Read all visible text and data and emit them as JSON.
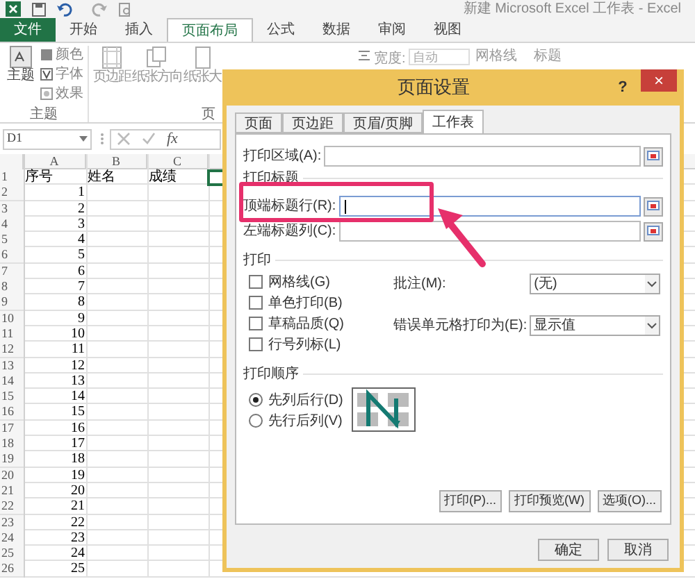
{
  "window": {
    "title": "新建 Microsoft Excel 工作表 - Excel"
  },
  "ribbon_tabs": [
    {
      "label": "文件",
      "kind": "file",
      "selected": false
    },
    {
      "label": "开始",
      "kind": "tab",
      "selected": false
    },
    {
      "label": "插入",
      "kind": "tab",
      "selected": false
    },
    {
      "label": "页面布局",
      "kind": "tab",
      "selected": true
    },
    {
      "label": "公式",
      "kind": "tab",
      "selected": false
    },
    {
      "label": "数据",
      "kind": "tab",
      "selected": false
    },
    {
      "label": "审阅",
      "kind": "tab",
      "selected": false
    },
    {
      "label": "视图",
      "kind": "tab",
      "selected": false
    }
  ],
  "ribbon": {
    "theme_group": {
      "big_button": "主题",
      "items": [
        "颜色",
        "字体",
        "效果"
      ],
      "label": "主题"
    },
    "page_setup_group": {
      "buttons": [
        "页边距",
        "纸张方向",
        "纸张大"
      ],
      "label": "页"
    },
    "scale_group": {
      "label": "宽度:",
      "value": "自动"
    },
    "sheet_options": [
      "网格线",
      "标题"
    ]
  },
  "formula_bar": {
    "name_box": "D1",
    "function_label": "fx"
  },
  "sheet": {
    "columns": [
      "A",
      "B",
      "C"
    ],
    "rows": [
      {
        "number": "1",
        "cells": [
          "序号",
          "姓名",
          "成绩"
        ]
      },
      {
        "number": "2",
        "cells": [
          "1"
        ]
      },
      {
        "number": "3",
        "cells": [
          "2"
        ]
      },
      {
        "number": "4",
        "cells": [
          "3"
        ]
      },
      {
        "number": "5",
        "cells": [
          "4"
        ]
      },
      {
        "number": "6",
        "cells": [
          "5"
        ]
      },
      {
        "number": "7",
        "cells": [
          "6"
        ]
      },
      {
        "number": "8",
        "cells": [
          "7"
        ]
      },
      {
        "number": "9",
        "cells": [
          "8"
        ]
      },
      {
        "number": "10",
        "cells": [
          "9"
        ]
      },
      {
        "number": "11",
        "cells": [
          "10"
        ]
      },
      {
        "number": "12",
        "cells": [
          "11"
        ]
      },
      {
        "number": "13",
        "cells": [
          "12"
        ]
      },
      {
        "number": "14",
        "cells": [
          "13"
        ]
      },
      {
        "number": "15",
        "cells": [
          "14"
        ]
      },
      {
        "number": "16",
        "cells": [
          "15"
        ]
      },
      {
        "number": "17",
        "cells": [
          "16"
        ]
      },
      {
        "number": "18",
        "cells": [
          "17"
        ]
      },
      {
        "number": "19",
        "cells": [
          "18"
        ]
      },
      {
        "number": "20",
        "cells": [
          "19"
        ]
      },
      {
        "number": "21",
        "cells": [
          "20"
        ]
      },
      {
        "number": "22",
        "cells": [
          "21"
        ]
      },
      {
        "number": "23",
        "cells": [
          "22"
        ]
      },
      {
        "number": "24",
        "cells": [
          "23"
        ]
      },
      {
        "number": "25",
        "cells": [
          "24"
        ]
      },
      {
        "number": "26",
        "cells": [
          "25"
        ]
      }
    ]
  },
  "dialog": {
    "title": "页面设置",
    "help": "?",
    "close": "×",
    "tabs": [
      {
        "label": "页面",
        "selected": false
      },
      {
        "label": "页边距",
        "selected": false
      },
      {
        "label": "页眉/页脚",
        "selected": false
      },
      {
        "label": "工作表",
        "selected": true
      }
    ],
    "print_area": {
      "label": "打印区域(A):"
    },
    "print_titles": {
      "heading": "打印标题",
      "fields": [
        {
          "label": "顶端标题行(R):",
          "focused": true
        },
        {
          "label": "左端标题列(C):",
          "focused": false
        }
      ]
    },
    "print": {
      "heading": "打印",
      "checkboxes": [
        {
          "label": "网格线(G)",
          "checked": false
        },
        {
          "label": "单色打印(B)",
          "checked": false
        },
        {
          "label": "草稿品质(Q)",
          "checked": false
        },
        {
          "label": "行号列标(L)",
          "checked": false
        }
      ],
      "dropdowns": [
        {
          "label": "批注(M):",
          "value": "(无)"
        },
        {
          "label": "错误单元格打印为(E):",
          "value": "显示值"
        }
      ]
    },
    "page_order": {
      "heading": "打印顺序",
      "options": [
        {
          "label": "先列后行(D)",
          "selected": true
        },
        {
          "label": "先行后列(V)",
          "selected": false
        }
      ]
    },
    "buttons": [
      "打印(P)...",
      "打印预览(W)",
      "选项(O)..."
    ],
    "footer_buttons": [
      "确定",
      "取消"
    ]
  }
}
